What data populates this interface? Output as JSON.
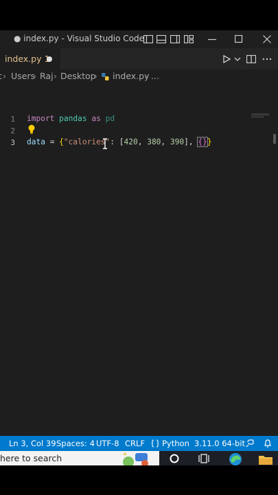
{
  "window": {
    "title": "● index.py - Visual Studio Code"
  },
  "tab": {
    "label": "index.py  1",
    "modified_dot": "●"
  },
  "breadcrumb": {
    "parts": [
      "c",
      "Users",
      "Raj",
      "Desktop",
      "index.py",
      "..."
    ],
    "separator": "›"
  },
  "editor": {
    "line_numbers": [
      "1",
      "2",
      "3"
    ],
    "line1": {
      "kw_import": "import",
      "module": "pandas",
      "kw_as": "as",
      "alias": "pd"
    },
    "line3": {
      "var": "data",
      "eq": " = ",
      "open": "{",
      "key": "\"calories\"",
      "colon": ": [",
      "n1": "420",
      "c1": ", ",
      "n2": "380",
      "c2": ", ",
      "n3": "390",
      "close_list": "], ",
      "empty_braces": "{}",
      "close": "}"
    }
  },
  "status": {
    "position": "Ln 3, Col 39",
    "spaces": "Spaces: 4",
    "encoding": "UTF-8",
    "eol": "CRLF",
    "language": "Python",
    "interpreter": "3.11.0 64-bit"
  },
  "taskbar": {
    "search_text": "here to search"
  },
  "colors": {
    "status_bar": "#007acc",
    "editor_bg": "#1e1e1e",
    "tab_modified": "#e2c08d"
  }
}
